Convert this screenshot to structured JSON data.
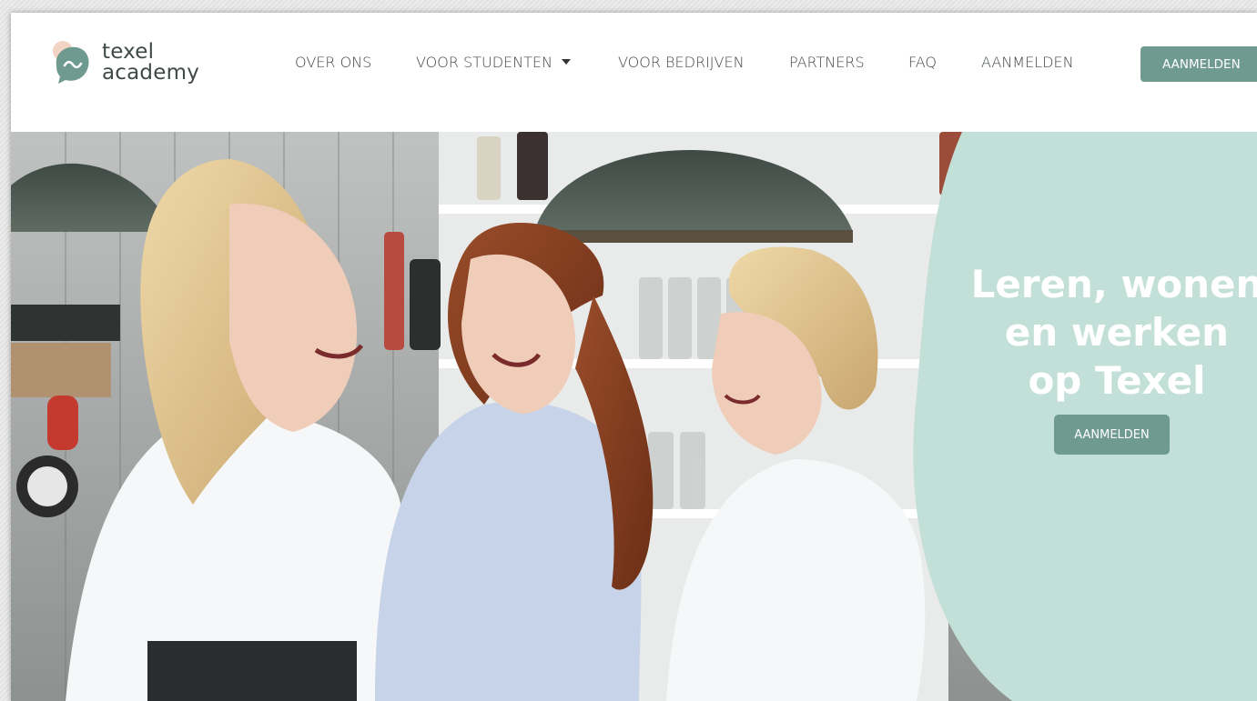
{
  "brand": {
    "line1": "texel",
    "line2": "academy",
    "logo_icon": "wave-bubble-icon",
    "colors": {
      "teal": "#6e9a8f",
      "mint": "#c3e0d8",
      "peach": "#f2d3c4",
      "text": "#3f4a47"
    }
  },
  "nav": {
    "items": [
      {
        "label": "OVER ONS"
      },
      {
        "label": "VOOR STUDENTEN",
        "dropdown": true
      },
      {
        "label": "VOOR BEDRIJVEN"
      },
      {
        "label": "PARTNERS"
      },
      {
        "label": "FAQ"
      },
      {
        "label": "AANMELDEN"
      }
    ],
    "cta_label": "AANMELDEN"
  },
  "hero": {
    "title_lines": [
      "Leren, wonen",
      "en werken",
      "op Texel"
    ],
    "cta_label": "AANMELDEN"
  }
}
